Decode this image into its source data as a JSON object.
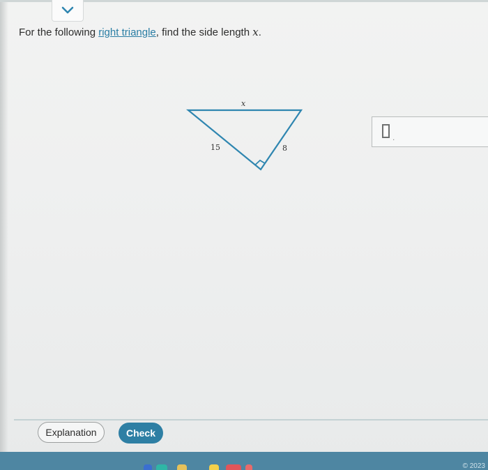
{
  "question": {
    "prefix": "For the following ",
    "link_text": "right triangle",
    "middle": ", find the side length ",
    "variable": "x",
    "suffix": "."
  },
  "figure": {
    "label_top": "x",
    "label_left": "15",
    "label_right": "8"
  },
  "answer": {
    "value": "",
    "suffix": "."
  },
  "buttons": {
    "explanation": "Explanation",
    "check": "Check"
  },
  "footer": {
    "copyright": "© 2023 "
  },
  "colors": {
    "accent": "#2e7fa4",
    "link": "#2a7da4",
    "triangle": "#2f86b0",
    "bottom_bar": "#4e86a2"
  },
  "icons": {
    "collapse": "chevron-down-icon",
    "right_angle": "right-angle-marker-icon"
  }
}
